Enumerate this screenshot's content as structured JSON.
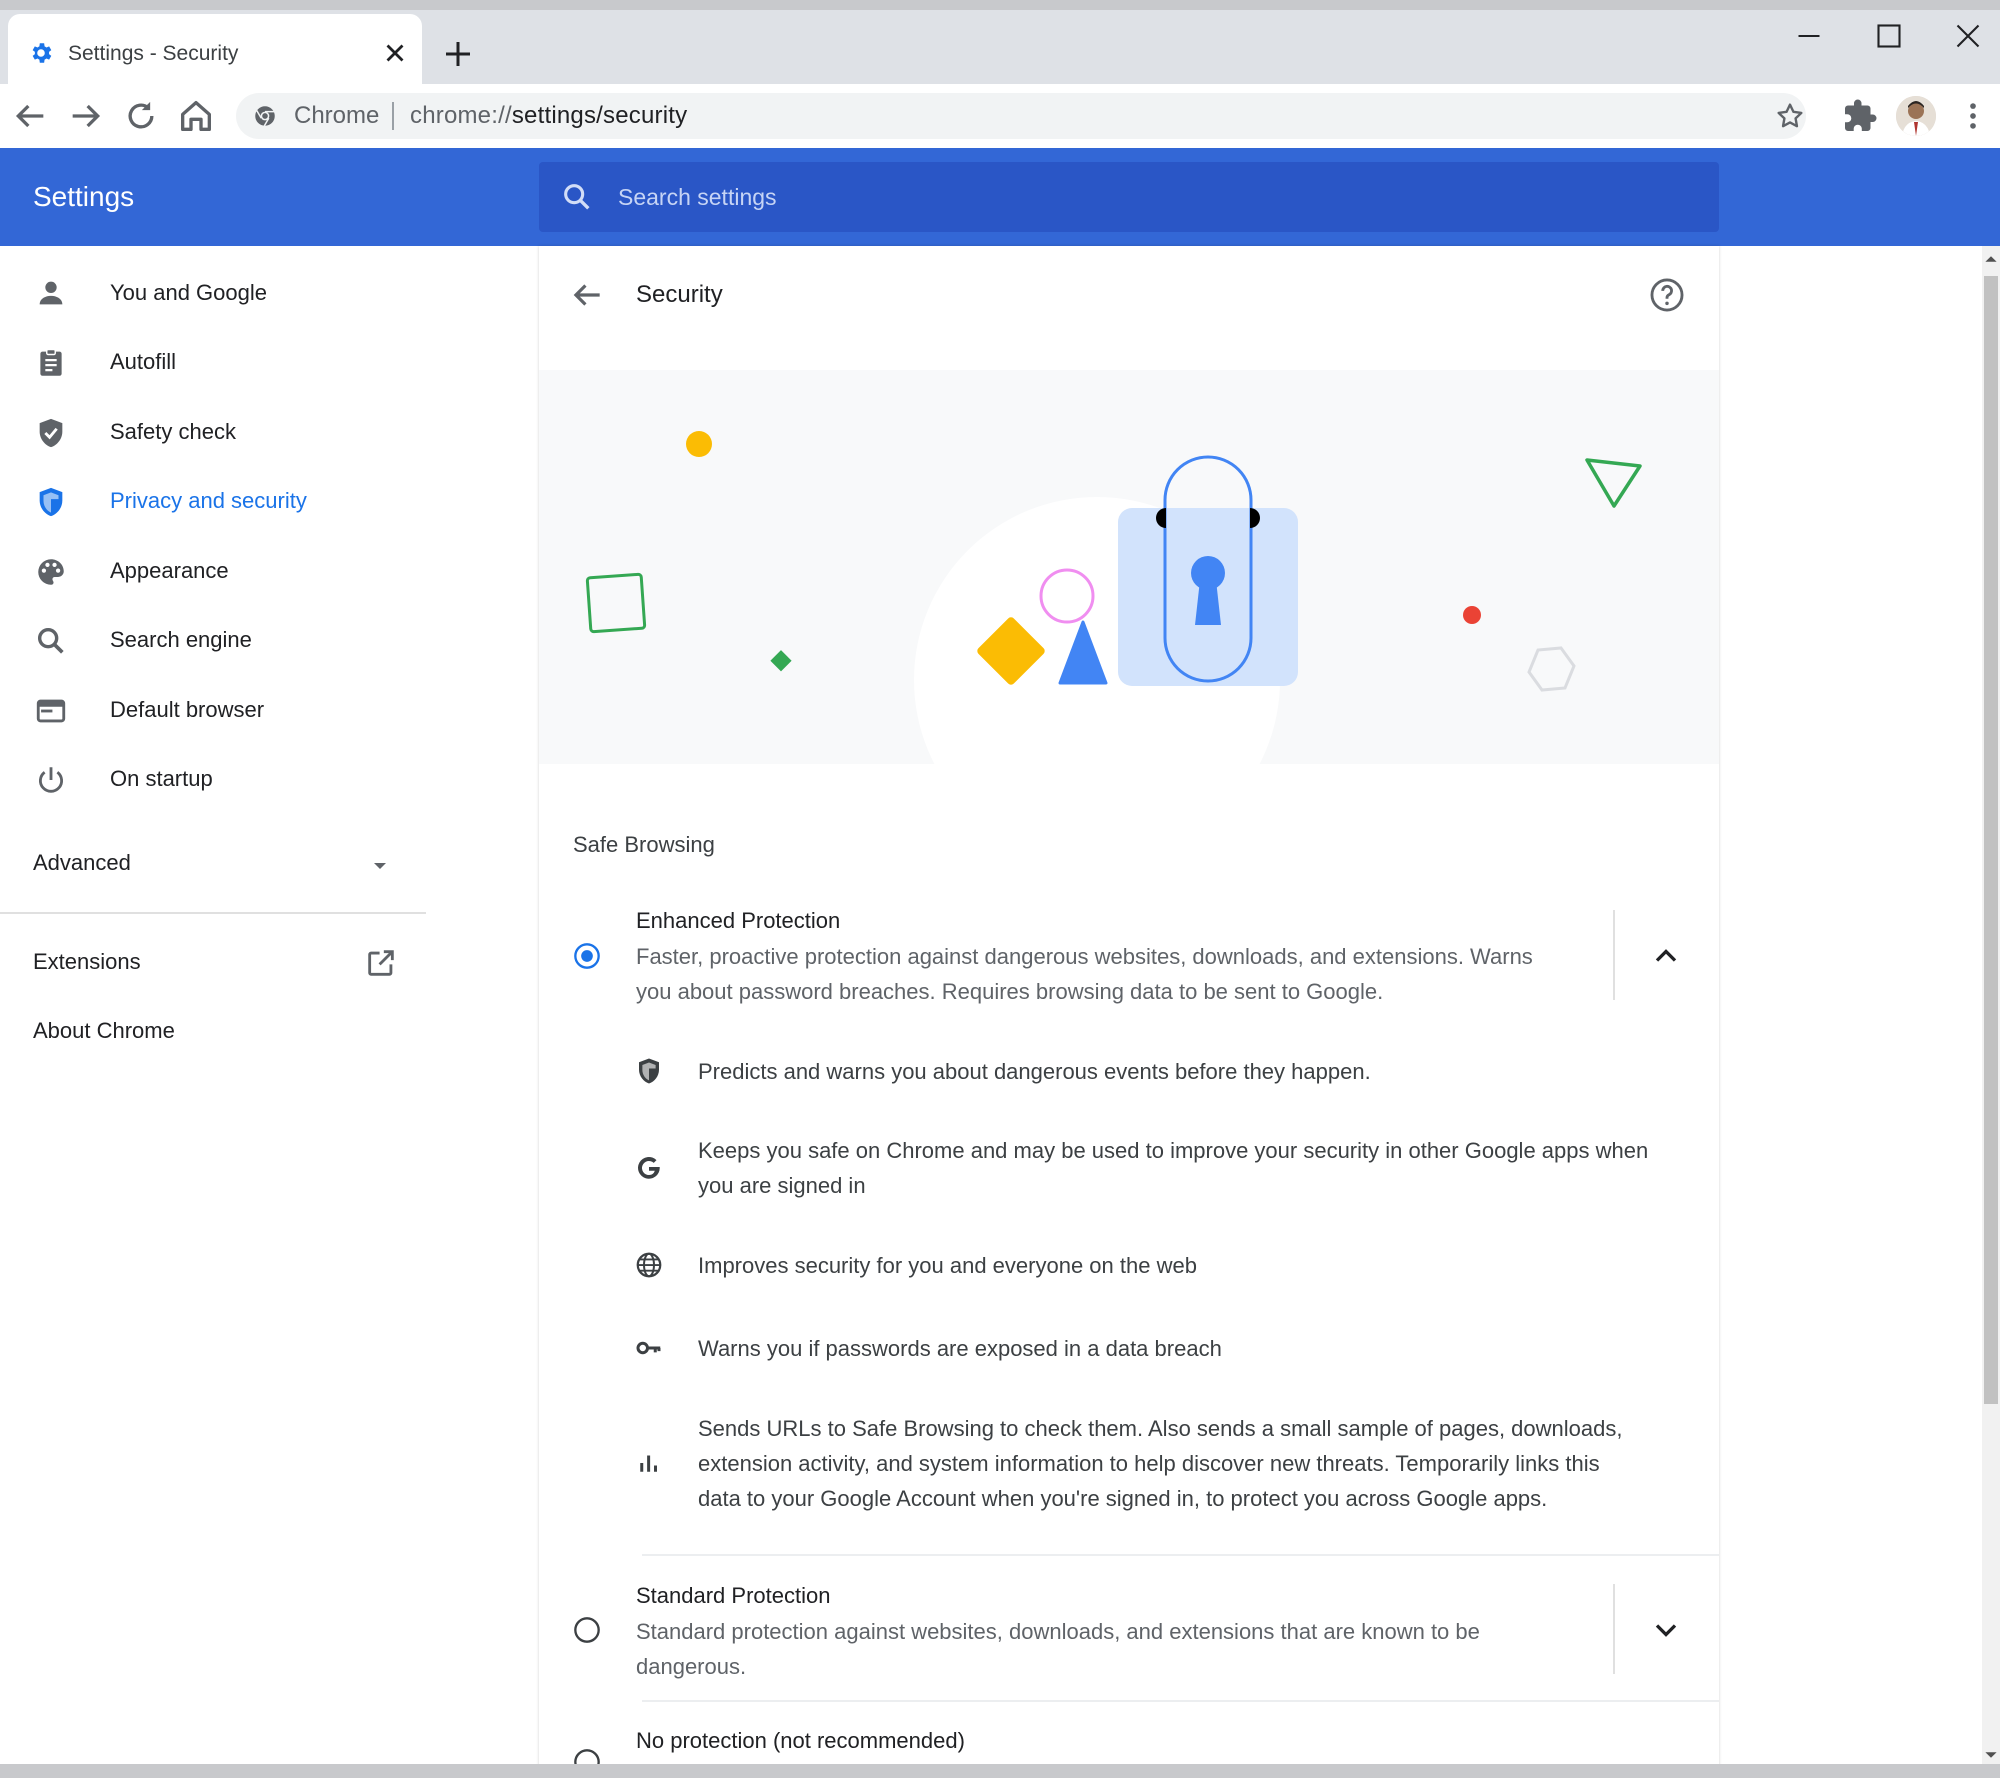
{
  "window": {
    "tab_title": "Settings - Security",
    "omnibox_chip": "Chrome",
    "url_prefix": "chrome://",
    "url_path": "settings/security"
  },
  "header": {
    "title": "Settings",
    "search_placeholder": "Search settings"
  },
  "sidebar": {
    "items": [
      {
        "label": "You and Google",
        "icon": "person-icon",
        "active": false
      },
      {
        "label": "Autofill",
        "icon": "clipboard-icon",
        "active": false
      },
      {
        "label": "Safety check",
        "icon": "shield-check-icon",
        "active": false
      },
      {
        "label": "Privacy and security",
        "icon": "shield-icon",
        "active": true
      },
      {
        "label": "Appearance",
        "icon": "palette-icon",
        "active": false
      },
      {
        "label": "Search engine",
        "icon": "search-icon",
        "active": false
      },
      {
        "label": "Default browser",
        "icon": "browser-window-icon",
        "active": false
      },
      {
        "label": "On startup",
        "icon": "power-icon",
        "active": false
      }
    ],
    "advanced_label": "Advanced",
    "extensions_label": "Extensions",
    "about_label": "About Chrome"
  },
  "page": {
    "title": "Security",
    "section_title": "Safe Browsing",
    "options": [
      {
        "title": "Enhanced Protection",
        "desc_line1": "Faster, proactive protection against dangerous websites, downloads, and extensions. Warns",
        "desc_line2": "you about password breaches. Requires browsing data to be sent to Google.",
        "selected": true,
        "expanded": true
      },
      {
        "title": "Standard Protection",
        "desc_line1": "Standard protection against websites, downloads, and extensions that are known to be",
        "desc_line2": "dangerous.",
        "selected": false,
        "expanded": false
      },
      {
        "title": "No protection (not recommended)",
        "selected": false
      }
    ],
    "features": [
      {
        "icon": "shield-icon",
        "line1": "Predicts and warns you about dangerous events before they happen.",
        "line2": "",
        "line3": ""
      },
      {
        "icon": "google-g-icon",
        "line1": "Keeps you safe on Chrome and may be used to improve your security in other Google apps when",
        "line2": "you are signed in",
        "line3": ""
      },
      {
        "icon": "globe-icon",
        "line1": "Improves security for you and everyone on the web",
        "line2": "",
        "line3": ""
      },
      {
        "icon": "key-icon",
        "line1": "Warns you if passwords are exposed in a data breach",
        "line2": "",
        "line3": ""
      },
      {
        "icon": "bar-chart-icon",
        "line1": "Sends URLs to Safe Browsing to check them. Also sends a small sample of pages, downloads,",
        "line2": "extension activity, and system information to help discover new threats. Temporarily links this",
        "line3": "data to your Google Account when you're signed in, to protect you across Google apps."
      }
    ]
  },
  "colors": {
    "accent": "#1a73e8",
    "header_blue": "#3367d6",
    "search_blue": "#2a56c6"
  }
}
